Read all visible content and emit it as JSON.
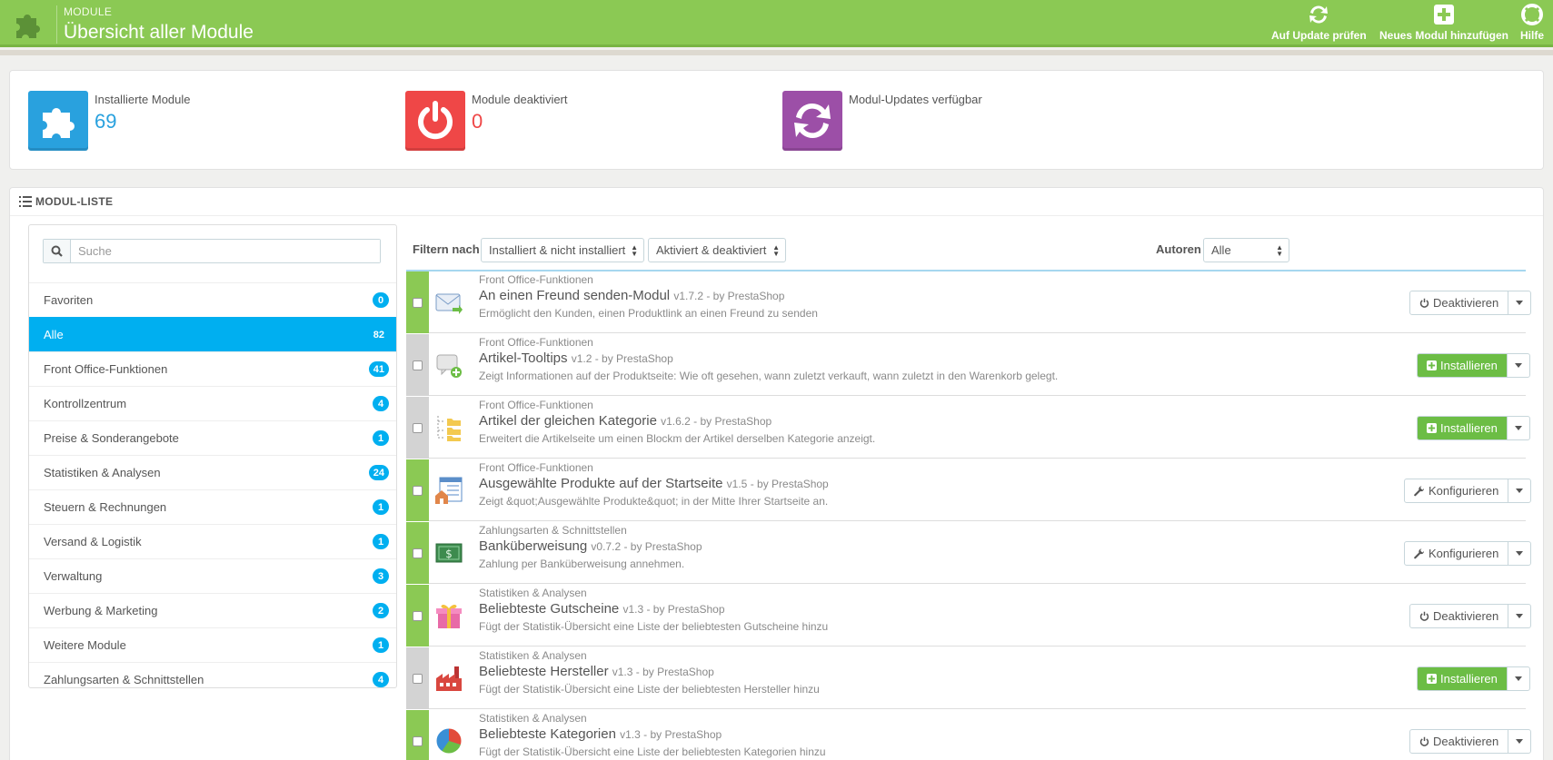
{
  "header": {
    "subtitle": "MODULE",
    "title": "Übersicht aller Module",
    "actions": [
      {
        "label": "Auf Update prüfen",
        "icon": "refresh-icon"
      },
      {
        "label": "Neues Modul hinzufügen",
        "icon": "add-icon"
      },
      {
        "label": "Hilfe",
        "icon": "help-lifebuoy-icon"
      }
    ]
  },
  "kpis": [
    {
      "label": "Installierte Module",
      "value": "69",
      "color": "#29a1de",
      "icon": "puzzle-icon"
    },
    {
      "label": "Module deaktiviert",
      "value": "0",
      "color": "#ef4747",
      "icon": "power-icon"
    },
    {
      "label": "Modul-Updates verfügbar",
      "value": "",
      "color": "#9c4fa7",
      "icon": "refresh-icon"
    }
  ],
  "panel": {
    "heading": "MODUL-LISTE"
  },
  "sidebar": {
    "search_placeholder": "Suche",
    "categories": [
      {
        "label": "Favoriten",
        "count": "0",
        "active": false
      },
      {
        "label": "Alle",
        "count": "82",
        "active": true
      },
      {
        "label": "Front Office-Funktionen",
        "count": "41",
        "active": false
      },
      {
        "label": "Kontrollzentrum",
        "count": "4",
        "active": false
      },
      {
        "label": "Preise & Sonderangebote",
        "count": "1",
        "active": false
      },
      {
        "label": "Statistiken & Analysen",
        "count": "24",
        "active": false
      },
      {
        "label": "Steuern & Rechnungen",
        "count": "1",
        "active": false
      },
      {
        "label": "Versand & Logistik",
        "count": "1",
        "active": false
      },
      {
        "label": "Verwaltung",
        "count": "3",
        "active": false
      },
      {
        "label": "Werbung & Marketing",
        "count": "2",
        "active": false
      },
      {
        "label": "Weitere Module",
        "count": "1",
        "active": false
      },
      {
        "label": "Zahlungsarten & Schnittstellen",
        "count": "4",
        "active": false
      }
    ]
  },
  "filters": {
    "filter_label": "Filtern nach",
    "install_select": "Installiert & nicht installiert",
    "status_select": "Aktiviert & deaktiviert",
    "authors_label": "Autoren",
    "authors_select": "Alle"
  },
  "modules": [
    {
      "category": "Front Office-Funktionen",
      "name": "An einen Freund senden-Modul",
      "meta": "v1.7.2 - by PrestaShop",
      "description": "Ermöglicht den Kunden, einen Produktlink an einen Freund zu senden",
      "status": "on",
      "action": "Deaktivieren",
      "action_type": "deactivate",
      "icon": "envelope-icon"
    },
    {
      "category": "Front Office-Funktionen",
      "name": "Artikel-Tooltips",
      "meta": "v1.2 - by PrestaShop",
      "description": "Zeigt Informationen auf der Produktseite: Wie oft gesehen, wann zuletzt verkauft, wann zuletzt in den Warenkorb gelegt.",
      "status": "off",
      "action": "Installieren",
      "action_type": "install",
      "icon": "tooltip-icon"
    },
    {
      "category": "Front Office-Funktionen",
      "name": "Artikel der gleichen Kategorie",
      "meta": "v1.6.2 - by PrestaShop",
      "description": "Erweitert die Artikelseite um einen Blockm der Artikel derselben Kategorie anzeigt.",
      "status": "off",
      "action": "Installieren",
      "action_type": "install",
      "icon": "folder-tree-icon"
    },
    {
      "category": "Front Office-Funktionen",
      "name": "Ausgewählte Produkte auf der Startseite",
      "meta": "v1.5 - by PrestaShop",
      "description": "Zeigt &quot;Ausgewählte Produkte&quot; in der Mitte Ihrer Startseite an.",
      "status": "on",
      "action": "Konfigurieren",
      "action_type": "configure",
      "icon": "homepage-icon"
    },
    {
      "category": "Zahlungsarten & Schnittstellen",
      "name": "Banküberweisung",
      "meta": "v0.7.2 - by PrestaShop",
      "description": "Zahlung per Banküberweisung annehmen.",
      "status": "on",
      "action": "Konfigurieren",
      "action_type": "configure",
      "icon": "banknote-icon"
    },
    {
      "category": "Statistiken & Analysen",
      "name": "Beliebteste Gutscheine",
      "meta": "v1.3 - by PrestaShop",
      "description": "Fügt der Statistik-Übersicht eine Liste der beliebtesten Gutscheine hinzu",
      "status": "on",
      "action": "Deaktivieren",
      "action_type": "deactivate",
      "icon": "gift-icon"
    },
    {
      "category": "Statistiken & Analysen",
      "name": "Beliebteste Hersteller",
      "meta": "v1.3 - by PrestaShop",
      "description": "Fügt der Statistik-Übersicht eine Liste der beliebtesten Hersteller hinzu",
      "status": "off",
      "action": "Installieren",
      "action_type": "install",
      "icon": "factory-icon"
    },
    {
      "category": "Statistiken & Analysen",
      "name": "Beliebteste Kategorien",
      "meta": "v1.3 - by PrestaShop",
      "description": "Fügt der Statistik-Übersicht eine Liste der beliebtesten Kategorien hinzu",
      "status": "on",
      "action": "Deaktivieren",
      "action_type": "deactivate",
      "icon": "pie-chart-icon"
    }
  ]
}
